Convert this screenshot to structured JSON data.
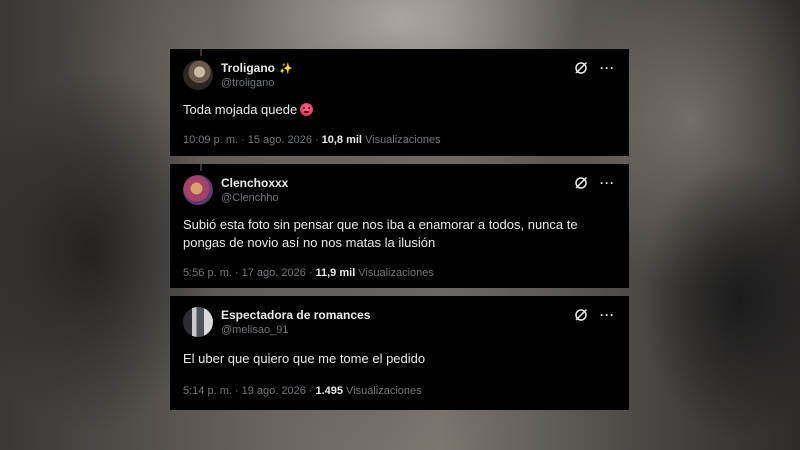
{
  "tweets": [
    {
      "name": "Troligano",
      "name_suffix": "✨",
      "handle": "@troligano",
      "text": "Toda mojada quede",
      "emoji": "hot-face-emoji",
      "time": "10:09 p. m.",
      "date": "15 ago. 2026",
      "views": "10,8 mil",
      "views_label": "Visualizaciones"
    },
    {
      "name": "Clenchoxxx",
      "handle": "@Clenchho",
      "text_line1": "Subió esta foto sin pensar que nos iba a enamorar a todos, nunca te",
      "text_line2": "pongas de novio así no nos matas la ilusión",
      "time": "5:56 p. m.",
      "date": "17 ago. 2026",
      "views": "11,9 mil",
      "views_label": "Visualizaciones"
    },
    {
      "name": "Espectadora de romances",
      "handle": "@melisao_91",
      "text": "El uber que quiero que me tome el pedido",
      "time": "5:14 p. m.",
      "date": "19 ago. 2026",
      "views": "1.495",
      "views_label": "Visualizaciones"
    }
  ],
  "separator": "·",
  "icons": {
    "grok": "grok-icon",
    "more": "more-options-icon"
  },
  "more_glyph": "···",
  "colors": {
    "card_bg": "#000000",
    "text": "#e7e9ea",
    "muted": "#71767b"
  }
}
